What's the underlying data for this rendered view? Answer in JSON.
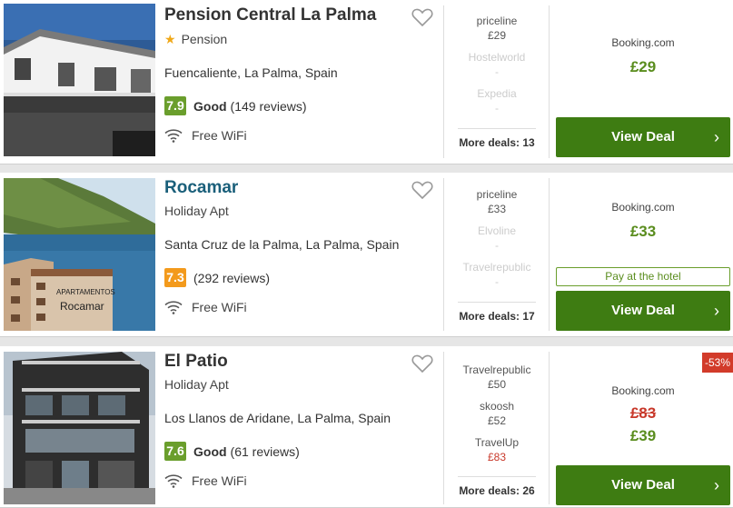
{
  "hotels": [
    {
      "name": "Pension Central La Palma",
      "type": "Pension",
      "location": "Fuencaliente, La Palma, Spain",
      "score": "7.9",
      "rating_label": "Good",
      "reviews": "(149 reviews)",
      "amenity": "Free WiFi",
      "providers": [
        {
          "name": "priceline",
          "price": "£29"
        },
        {
          "name": "Hostelworld",
          "price": "-"
        },
        {
          "name": "Expedia",
          "price": "-"
        }
      ],
      "more_deals": "More deals: 13",
      "best_site": "Booking.com",
      "best_price": "£29",
      "cta": "View Deal"
    },
    {
      "name": "Rocamar",
      "type": "Holiday Apt",
      "location": "Santa Cruz de la Palma, La Palma, Spain",
      "score": "7.3",
      "reviews": "(292 reviews)",
      "amenity": "Free WiFi",
      "providers": [
        {
          "name": "priceline",
          "price": "£33"
        },
        {
          "name": "Elvoline",
          "price": "-"
        },
        {
          "name": "Travelrepublic",
          "price": "-"
        }
      ],
      "more_deals": "More deals: 17",
      "best_site": "Booking.com",
      "best_price": "£33",
      "pay_note": "Pay at the hotel",
      "cta": "View Deal",
      "photo_text_1": "APARTAMENTOS",
      "photo_text_2": "Rocamar"
    },
    {
      "name": "El Patio",
      "type": "Holiday Apt",
      "location": "Los Llanos de Aridane, La Palma, Spain",
      "score": "7.6",
      "rating_label": "Good",
      "reviews": "(61 reviews)",
      "amenity": "Free WiFi",
      "providers": [
        {
          "name": "Travelrepublic",
          "price": "£50"
        },
        {
          "name": "skoosh",
          "price": "£52"
        },
        {
          "name": "TravelUp",
          "price": "£83"
        }
      ],
      "more_deals": "More deals: 26",
      "best_site": "Booking.com",
      "old_price": "£83",
      "best_price": "£39",
      "discount": "-53%",
      "cta": "View Deal"
    }
  ],
  "colors": {
    "cta_green": "#3e7c12",
    "price_green": "#5a8d1e",
    "score_green": "#6a9e2c",
    "score_orange": "#f39a1c",
    "discount_red": "#d23b2a",
    "hotel_link_teal": "#1a5f7a"
  },
  "icons": [
    "heart-icon",
    "star-icon",
    "wifi-icon",
    "chevron-right-icon"
  ]
}
